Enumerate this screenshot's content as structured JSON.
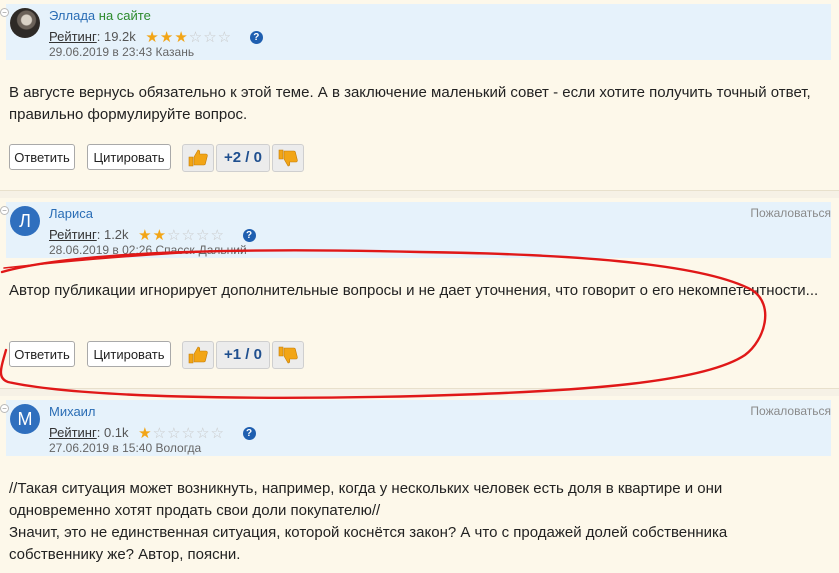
{
  "comments": [
    {
      "author": "Эллада",
      "online_label": "на сайте",
      "avatar_letter": "",
      "complain": "",
      "rating_label": "Рейтинг",
      "rating_value": "19.2k",
      "stars_filled": 3,
      "stars_total": 6,
      "date": "29.06.2019 в 23:43",
      "city": "Казань",
      "text": "В августе вернусь обязательно к этой теме. А в заключение маленький совет - если хотите получить точный ответ, правильно формулируйте вопрос.",
      "reply_label": "Ответить",
      "quote_label": "Цитировать",
      "score": "+2 / 0"
    },
    {
      "author": "Лариса",
      "online_label": "",
      "avatar_letter": "Л",
      "complain": "Пожаловаться",
      "rating_label": "Рейтинг",
      "rating_value": "1.2k",
      "stars_filled": 2,
      "stars_total": 6,
      "date": "28.06.2019 в 02:26",
      "city": "Спасск-Дальний",
      "text": "Автор публикации игнорирует дополнительные вопросы и не дает уточнения, что говорит о его некомпетентности...",
      "reply_label": "Ответить",
      "quote_label": "Цитировать",
      "score": "+1 / 0"
    },
    {
      "author": "Михаил",
      "online_label": "",
      "avatar_letter": "М",
      "complain": "Пожаловаться",
      "rating_label": "Рейтинг",
      "rating_value": "0.1k",
      "stars_filled": 1,
      "stars_total": 6,
      "date": "27.06.2019 в 15:40",
      "city": "Вологда",
      "text_lines": [
        "//Такая ситуация может возникнуть, например, когда у нескольких человек есть доля в квартире и они одновременно хотят продать свои доли покупателю//",
        "Значит, это не единственная ситуация, которой коснётся закон? А что с продажей долей собственника собственнику же? Автор, поясни."
      ]
    }
  ],
  "colors": {
    "accent_blue": "#2a6db5",
    "star": "#f2a516",
    "annotation_red": "#e01818",
    "header_bg": "#e6f2fb"
  }
}
